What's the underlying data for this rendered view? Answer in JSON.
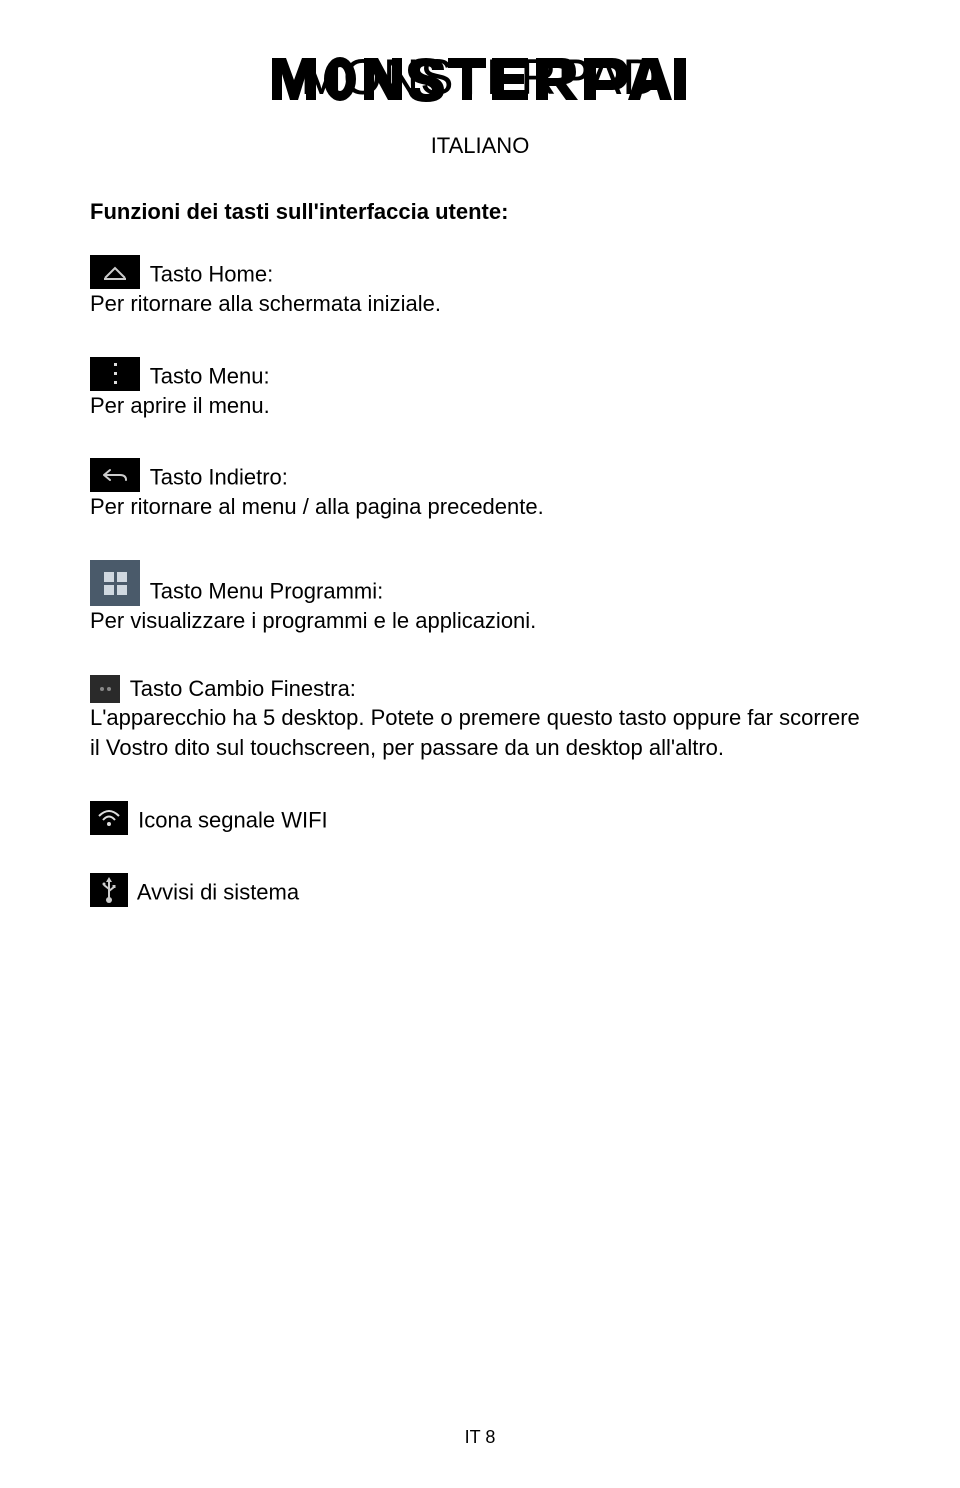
{
  "header": {
    "subtitle": "ITALIANO"
  },
  "section": {
    "heading": "Funzioni dei tasti sull'interfaccia utente:"
  },
  "items": {
    "home": {
      "title": "Tasto Home:",
      "desc": "Per ritornare alla schermata iniziale."
    },
    "menu": {
      "title": "Tasto Menu:",
      "desc": "Per aprire il menu."
    },
    "back": {
      "title": "Tasto Indietro:",
      "desc": "Per ritornare al menu / alla pagina precedente."
    },
    "programs": {
      "title": "Tasto Menu Programmi:",
      "desc": "Per visualizzare i programmi e le applicazioni."
    },
    "switch": {
      "title": "Tasto Cambio Finestra:",
      "desc": "L'apparecchio ha 5 desktop. Potete o premere questo tasto oppure far scorrere il Vostro dito sul touchscreen, per passare da un desktop all'altro."
    },
    "wifi": {
      "title": "Icona segnale WIFI"
    },
    "usb": {
      "title": "Avvisi di sistema"
    }
  },
  "footer": {
    "page": "IT 8"
  }
}
